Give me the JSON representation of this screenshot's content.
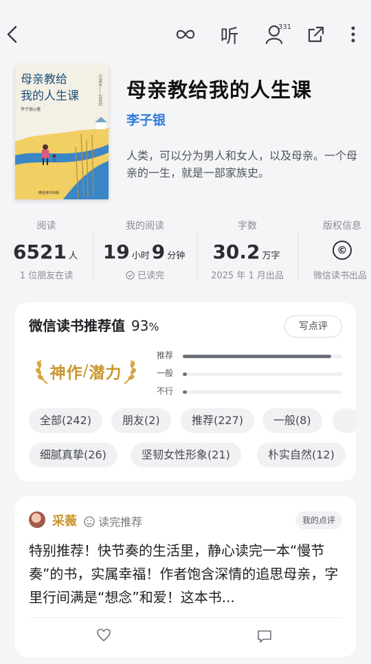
{
  "topbar": {
    "listen_label": "听",
    "friends_count": "331"
  },
  "book": {
    "title": "母亲教给我的人生课",
    "author": "李子银",
    "intro": "人类，可以分为男人和女人，以及母亲。一个母亲的一生，就是一部家族史。",
    "cover": {
      "title_line1": "母亲教给",
      "title_line2": "我的人生课",
      "author": "李子银◎著",
      "vertical": "（1964——2005）",
      "publisher": "微信读书出版"
    }
  },
  "stats": {
    "reading": {
      "label": "阅读",
      "value": "6521",
      "unit": "人",
      "sub": "1 位朋友在读"
    },
    "my_reading": {
      "label": "我的阅读",
      "hours": "19",
      "hours_unit": "小时",
      "minutes": "9",
      "minutes_unit": "分钟",
      "sub": "已读完"
    },
    "words": {
      "label": "字数",
      "value": "30.2",
      "unit": "万字",
      "sub": "2025 年 1 月出品"
    },
    "copyright": {
      "label": "版权信息",
      "symbol": "©",
      "sub": "微信读书出品"
    }
  },
  "rating": {
    "title": "微信读书推荐值",
    "value": "93",
    "percent_sign": "%",
    "write_button": "写点评",
    "badge_left": "神作",
    "badge_slash": "/",
    "badge_right": "潜力",
    "bars": [
      {
        "label": "推荐",
        "fraction": 0.93
      },
      {
        "label": "一般",
        "fraction": 0.02
      },
      {
        "label": "不行",
        "fraction": 0.02
      }
    ],
    "chips_row1": [
      "全部(242)",
      "朋友(2)",
      "推荐(227)",
      "一般(8)"
    ],
    "chips_row2": [
      "细腻真挚(26)",
      "坚韧女性形象(21)",
      "朴实自然(12)"
    ]
  },
  "review": {
    "name": "采薇",
    "tag": "读完推荐",
    "my_review_label": "我的点评",
    "text": "特别推荐！快节奏的生活里，静心读完一本“慢节奏”的书，实属幸福！作者饱含深情的追思母亲，字里行间满是“想念”和爱！这本书..."
  },
  "colors": {
    "accent_blue": "#2f7ad9",
    "gold": "#c9962f",
    "background": "#f4f5f7"
  }
}
